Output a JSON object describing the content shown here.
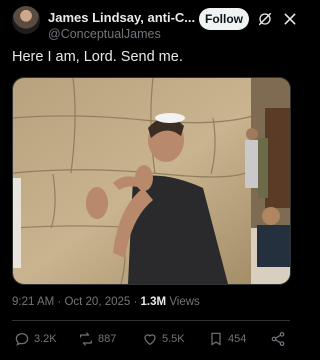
{
  "post": {
    "author_name": "James Lindsay, anti-C...",
    "author_handle": "@ConceptualJames",
    "follow_label": "Follow",
    "text": "Here I am, Lord. Send me.",
    "time": "9:21 AM",
    "date": "Oct 20, 2025",
    "views_count": "1.3M",
    "views_label": "Views"
  },
  "actions": {
    "replies": "3.2K",
    "reposts": "887",
    "likes": "5.5K",
    "bookmarks": "454"
  },
  "icons": {
    "verified": "verified-badge-icon",
    "grok": "grok-icon",
    "close": "close-icon",
    "reply": "reply-icon",
    "repost": "repost-icon",
    "like": "heart-icon",
    "bookmark": "bookmark-icon",
    "share": "share-icon"
  },
  "colors": {
    "background": "#000000",
    "verified": "#1d9bf0",
    "secondary_text": "#71767b"
  }
}
